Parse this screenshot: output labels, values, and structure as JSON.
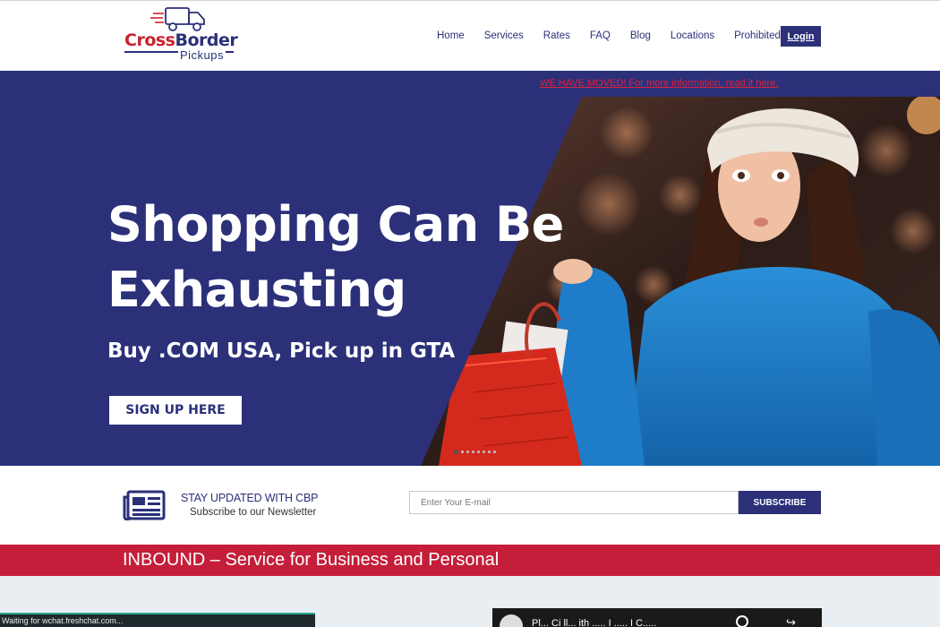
{
  "header": {
    "logo": {
      "brand_part1": "Cross",
      "brand_part2": "Border",
      "sub": "Pickups"
    },
    "nav": [
      "Home",
      "Services",
      "Rates",
      "FAQ",
      "Blog",
      "Locations",
      "Prohibited"
    ],
    "login_label": "Login"
  },
  "hero": {
    "notice": "WE HAVE MOVED! For more information, read it here.",
    "headline_line1": "Shopping Can Be",
    "headline_line2": "Exhausting",
    "subheadline": "Buy .COM USA, Pick up in GTA",
    "cta_label": "SIGN UP HERE",
    "slide_count": 8,
    "active_slide": 1
  },
  "newsletter": {
    "title": "STAY UPDATED WITH CBP",
    "subtitle": "Subscribe to our Newsletter",
    "email_placeholder": "Enter Your E-mail",
    "subscribe_label": "SUBSCRIBE"
  },
  "inbound": {
    "title": "INBOUND – Service for Business and Personal"
  },
  "status_bar": {
    "text": "Waiting for wchat.freshchat.com..."
  },
  "video": {
    "title": "Pl... Ci ll... ith ..... I ..... I C....."
  },
  "colors": {
    "primary": "#2b3079",
    "accent_red": "#c41e3a",
    "notice_red": "#e0203a",
    "section_bg": "#e8eef2"
  }
}
